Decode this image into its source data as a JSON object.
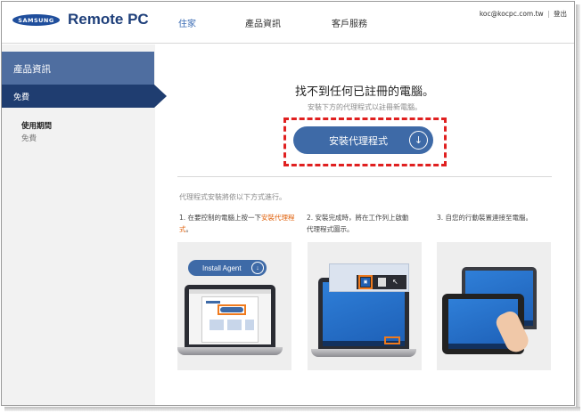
{
  "header": {
    "logo_text": "SAMSUNG",
    "app_title": "Remote PC",
    "nav": [
      {
        "label": "住家",
        "active": true
      },
      {
        "label": "產品資訊",
        "active": false
      },
      {
        "label": "客戶服務",
        "active": false
      }
    ],
    "account_email": "koc@kocpc.com.tw",
    "account_sep": "|",
    "logout_label": "登出"
  },
  "sidebar": {
    "heading": "產品資訊",
    "selected_item": "免費",
    "period_label": "使用期間",
    "period_value": "免費"
  },
  "main": {
    "headline": "找不到任何已註冊的電腦。",
    "subline": "安裝下方的代理程式以註冊新電腦。",
    "install_button": "安裝代理程式",
    "process_intro": "代理程式安裝將依以下方式進行。",
    "steps": [
      {
        "prefix": "1. 在要控制的電腦上按一下",
        "highlight": "安裝代理程式",
        "suffix": "。"
      },
      {
        "text": "2. 安裝完成時，將在工作列上啟動代理程式圖示。"
      },
      {
        "text": "3. 自您的行動裝置連接至電腦。"
      }
    ],
    "illustration_button": "Install Agent"
  },
  "colors": {
    "brand_blue": "#3e6aa7",
    "sidebar_dark": "#1f3d70",
    "sidebar_head": "#4f6ea0",
    "highlight_orange": "#e0620d",
    "dashed_red": "#e02020"
  },
  "icons": [
    "download-icon",
    "samsung-logo"
  ]
}
